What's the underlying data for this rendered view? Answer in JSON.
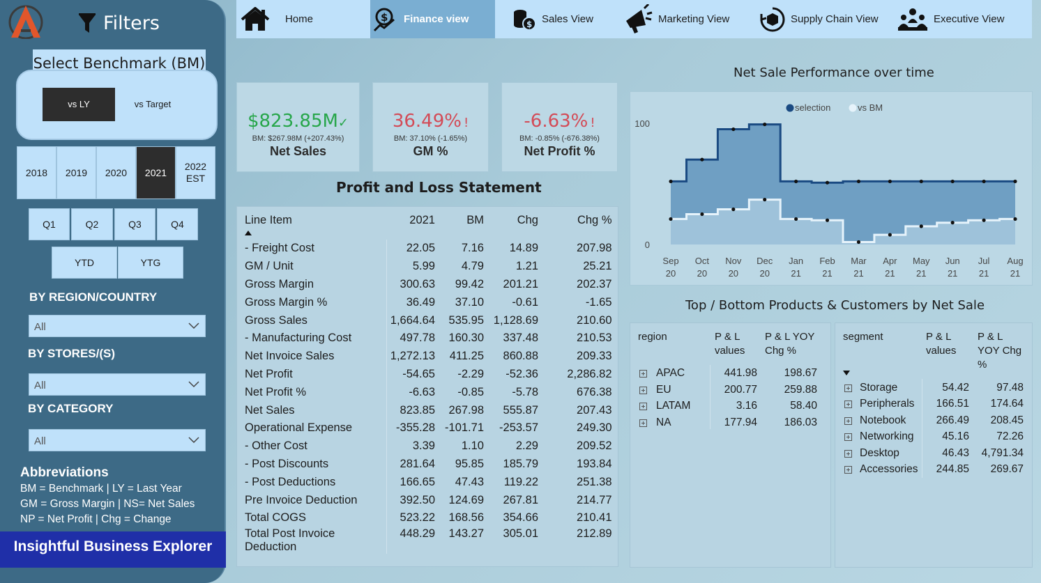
{
  "sidebar": {
    "filters_title": "Filters",
    "benchmark_label": "Select Benchmark (BM)",
    "benchmark_options": [
      "vs LY",
      "vs Target"
    ],
    "years": [
      "2018",
      "2019",
      "2020",
      "2021",
      "2022 EST"
    ],
    "selected_year": "2021",
    "quarters": [
      "Q1",
      "Q2",
      "Q3",
      "Q4"
    ],
    "periods": [
      "YTD",
      "YTG"
    ],
    "region_heading": "BY REGION/COUNTRY",
    "region_value": "All",
    "stores_heading": "BY STORES/(S)",
    "stores_value": "All",
    "category_heading": "BY CATEGORY",
    "category_value": "All",
    "abbr_heading": "Abbreviations",
    "abbr_lines": [
      "BM = Benchmark | LY = Last Year",
      "GM = Gross Margin | NS= Net Sales",
      "NP = Net Profit | Chg = Change"
    ],
    "brand": "Insightful Business Explorer"
  },
  "nav": {
    "items": [
      "Home",
      "Finance view",
      "Sales View",
      "Marketing View",
      "Supply Chain View",
      "Executive View"
    ],
    "active": "Finance view"
  },
  "kpis": [
    {
      "value": "$823.85M",
      "mark": "✓",
      "sub": "BM: $267.98M (+207.43%)",
      "label": "Net Sales",
      "tone": "pos"
    },
    {
      "value": "36.49%",
      "mark": "!",
      "sub": "BM: 37.10% (-1.65%)",
      "label": "GM %",
      "tone": "neg"
    },
    {
      "value": "-6.63%",
      "mark": "!",
      "sub": "BM: -0.85% (-676.38%)",
      "label": "Net Profit %",
      "tone": "neg"
    }
  ],
  "pl": {
    "title": "Profit and Loss Statement",
    "columns": [
      "Line Item",
      "2021",
      "BM",
      "Chg",
      "Chg %"
    ],
    "rows": [
      [
        "- Freight Cost",
        "22.05",
        "7.16",
        "14.89",
        "207.98"
      ],
      [
        "GM / Unit",
        "5.99",
        "4.79",
        "1.21",
        "25.21"
      ],
      [
        "Gross Margin",
        "300.63",
        "99.42",
        "201.21",
        "202.37"
      ],
      [
        "Gross Margin %",
        "36.49",
        "37.10",
        "-0.61",
        "-1.65"
      ],
      [
        "Gross Sales",
        "1,664.64",
        "535.95",
        "1,128.69",
        "210.60"
      ],
      [
        "- Manufacturing Cost",
        "497.78",
        "160.30",
        "337.48",
        "210.53"
      ],
      [
        "Net Invoice Sales",
        "1,272.13",
        "411.25",
        "860.88",
        "209.33"
      ],
      [
        "Net Profit",
        "-54.65",
        "-2.29",
        "-52.36",
        "2,286.82"
      ],
      [
        "Net Profit %",
        "-6.63",
        "-0.85",
        "-5.78",
        "676.38"
      ],
      [
        "Net Sales",
        "823.85",
        "267.98",
        "555.87",
        "207.43"
      ],
      [
        "Operational Expense",
        "-355.28",
        "-101.71",
        "-253.57",
        "249.30"
      ],
      [
        "- Other Cost",
        "3.39",
        "1.10",
        "2.29",
        "209.52"
      ],
      [
        "- Post Discounts",
        "281.64",
        "95.85",
        "185.79",
        "193.84"
      ],
      [
        "- Post Deductions",
        "166.65",
        "47.43",
        "119.22",
        "251.38"
      ],
      [
        "Pre Invoice Deduction",
        "392.50",
        "124.69",
        "267.81",
        "214.77"
      ],
      [
        "Total COGS",
        "523.22",
        "168.56",
        "354.66",
        "210.41"
      ],
      [
        "Total Post Invoice Deduction",
        "448.29",
        "143.27",
        "305.01",
        "212.89"
      ]
    ]
  },
  "chart_title": "Net Sale Performance over time",
  "chart_data": {
    "type": "area",
    "title": "Net Sale Performance over time",
    "x": [
      "Sep 20",
      "Oct 20",
      "Nov 20",
      "Dec 20",
      "Jan 21",
      "Feb 21",
      "Mar 21",
      "Apr 21",
      "May 21",
      "Jun 21",
      "Jul 21",
      "Aug 21"
    ],
    "series": [
      {
        "name": "selection",
        "values": [
          52,
          70,
          95,
          99,
          52,
          51,
          52,
          52,
          52,
          52,
          52,
          52
        ],
        "color": "#1a4a82"
      },
      {
        "name": "vs BM",
        "values": [
          21,
          25,
          29,
          37,
          21,
          20,
          2,
          8,
          15,
          18,
          20,
          21
        ],
        "color": "#e6f3fb"
      }
    ],
    "ylim": [
      0,
      120
    ],
    "yticks": [
      "0",
      "100"
    ],
    "legend": "top"
  },
  "products_title": "Top / Bottom Products & Customers by Net Sale",
  "region_table": {
    "headers": [
      "region",
      "P & L values",
      "P & L YOY Chg %"
    ],
    "rows": [
      [
        "APAC",
        "441.98",
        "198.67"
      ],
      [
        "EU",
        "200.77",
        "259.88"
      ],
      [
        "LATAM",
        "3.16",
        "58.40"
      ],
      [
        "NA",
        "177.94",
        "186.03"
      ]
    ]
  },
  "segment_table": {
    "headers": [
      "segment",
      "P & L values",
      "P & L YOY Chg %"
    ],
    "rows": [
      [
        "Storage",
        "54.42",
        "97.48"
      ],
      [
        "Peripherals",
        "166.51",
        "174.64"
      ],
      [
        "Notebook",
        "266.49",
        "208.45"
      ],
      [
        "Networking",
        "45.16",
        "72.26"
      ],
      [
        "Desktop",
        "46.43",
        "4,791.34"
      ],
      [
        "Accessories",
        "244.85",
        "269.67"
      ]
    ]
  },
  "colors": {
    "accent": "#1f2fa8",
    "sidebar": "#3d6a86",
    "panel": "#bfe1fa",
    "positive": "#27a64a",
    "negative": "#d34b57"
  }
}
